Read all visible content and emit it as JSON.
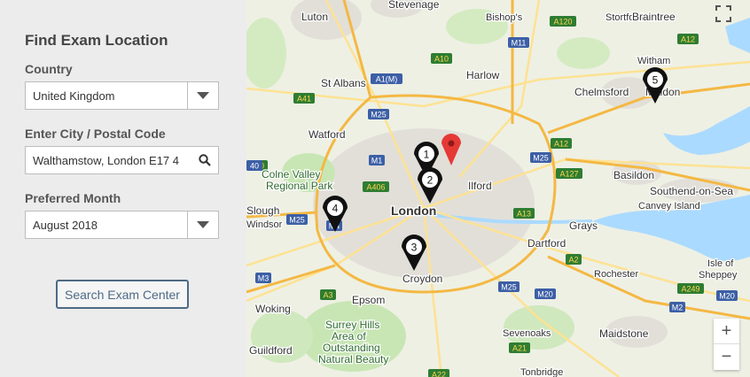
{
  "sidebar": {
    "title": "Find Exam Location",
    "country_label": "Country",
    "country_value": "United Kingdom",
    "city_label": "Enter City / Postal Code",
    "city_value": "Walthamstow, London E17 4",
    "month_label": "Preferred Month",
    "month_value": "August 2018",
    "search_button": "Search Exam Center"
  },
  "map": {
    "places": [
      {
        "name": "Stevenage",
        "cls": "town"
      },
      {
        "name": "Luton",
        "cls": "town"
      },
      {
        "name": "Bishop's",
        "cls": "small"
      },
      {
        "name": "Stortford",
        "cls": "small"
      },
      {
        "name": "Braintree",
        "cls": "town"
      },
      {
        "name": "Harlow",
        "cls": "town"
      },
      {
        "name": "Witham",
        "cls": "small"
      },
      {
        "name": "St Albans",
        "cls": "town"
      },
      {
        "name": "Chelmsford",
        "cls": "town"
      },
      {
        "name": "Maldon",
        "cls": "town"
      },
      {
        "name": "Watford",
        "cls": "town"
      },
      {
        "name": "Colne Valley",
        "cls": "park"
      },
      {
        "name": "Regional Park",
        "cls": "park"
      },
      {
        "name": "Ilford",
        "cls": "town"
      },
      {
        "name": "Basildon",
        "cls": "town"
      },
      {
        "name": "Southend-on-Sea",
        "cls": "town"
      },
      {
        "name": "Slough",
        "cls": "town"
      },
      {
        "name": "London",
        "cls": "city"
      },
      {
        "name": "Canvey Island",
        "cls": "small"
      },
      {
        "name": "Windsor",
        "cls": "small"
      },
      {
        "name": "Grays",
        "cls": "town"
      },
      {
        "name": "Dartford",
        "cls": "town"
      },
      {
        "name": "Croydon",
        "cls": "town"
      },
      {
        "name": "Rochester",
        "cls": "small"
      },
      {
        "name": "Isle of",
        "cls": "small"
      },
      {
        "name": "Sheppey",
        "cls": "small"
      },
      {
        "name": "Woking",
        "cls": "town"
      },
      {
        "name": "Epsom",
        "cls": "town"
      },
      {
        "name": "Surrey Hills",
        "cls": "park"
      },
      {
        "name": "Area of",
        "cls": "park"
      },
      {
        "name": "Outstanding",
        "cls": "park"
      },
      {
        "name": "Natural Beauty",
        "cls": "park"
      },
      {
        "name": "Sevenoaks",
        "cls": "small"
      },
      {
        "name": "Maidstone",
        "cls": "town"
      },
      {
        "name": "Guildford",
        "cls": "town"
      },
      {
        "name": "Tonbridge",
        "cls": "small"
      }
    ],
    "road_shields": [
      {
        "label": "A120",
        "type": "a"
      },
      {
        "label": "M11",
        "type": "m"
      },
      {
        "label": "A10",
        "type": "a"
      },
      {
        "label": "A12",
        "type": "a"
      },
      {
        "label": "A41",
        "type": "a"
      },
      {
        "label": "A1(M)",
        "type": "m"
      },
      {
        "label": "M25",
        "type": "m"
      },
      {
        "label": "M1",
        "type": "m"
      },
      {
        "label": "A12",
        "type": "a"
      },
      {
        "label": "M25",
        "type": "m"
      },
      {
        "label": "A127",
        "type": "a"
      },
      {
        "label": "A406",
        "type": "a"
      },
      {
        "label": "A40",
        "type": "a"
      },
      {
        "label": "M25",
        "type": "m"
      },
      {
        "label": "A13",
        "type": "a"
      },
      {
        "label": "A2",
        "type": "a"
      },
      {
        "label": "M4",
        "type": "m"
      },
      {
        "label": "M3",
        "type": "m"
      },
      {
        "label": "A3",
        "type": "a"
      },
      {
        "label": "M25",
        "type": "m"
      },
      {
        "label": "M20",
        "type": "m"
      },
      {
        "label": "A249",
        "type": "a"
      },
      {
        "label": "M2",
        "type": "m"
      },
      {
        "label": "M20",
        "type": "m"
      },
      {
        "label": "A21",
        "type": "a"
      },
      {
        "label": "A22",
        "type": "a"
      },
      {
        "label": "40",
        "type": "m"
      }
    ],
    "markers": [
      "1",
      "2",
      "3",
      "4",
      "5"
    ],
    "zoom_in": "+",
    "zoom_out": "−",
    "colors": {
      "water": "#aadaff",
      "park": "#c8e6b4",
      "motorway": "#f4b843",
      "road": "#fde293",
      "urban": "#e0ddd7",
      "pin": "#e53935"
    }
  }
}
